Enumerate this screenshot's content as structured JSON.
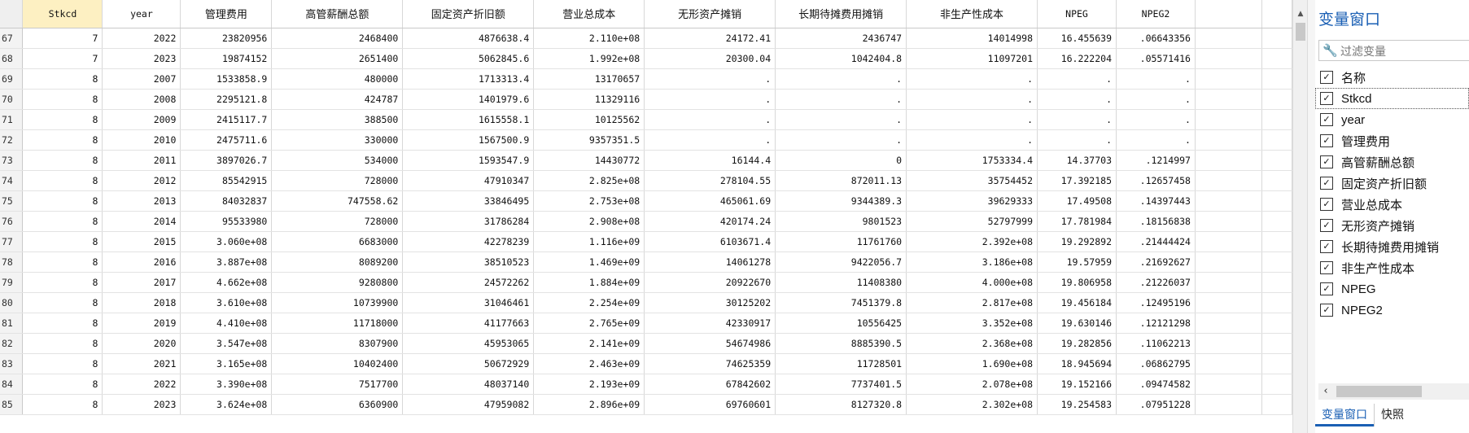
{
  "columns": [
    "Stkcd",
    "year",
    "管理费用",
    "高管薪酬总额",
    "固定资产折旧额",
    "营业总成本",
    "无形资产摊销",
    "长期待摊费用摊销",
    "非生产性成本",
    "NPEG",
    "NPEG2"
  ],
  "rows": [
    [
      "67",
      "7",
      "2022",
      "23820956",
      "2468400",
      "4876638.4",
      "2.110e+08",
      "24172.41",
      "2436747",
      "14014998",
      "16.455639",
      ".06643356"
    ],
    [
      "68",
      "7",
      "2023",
      "19874152",
      "2651400",
      "5062845.6",
      "1.992e+08",
      "20300.04",
      "1042404.8",
      "11097201",
      "16.222204",
      ".05571416"
    ],
    [
      "69",
      "8",
      "2007",
      "1533858.9",
      "480000",
      "1713313.4",
      "13170657",
      ".",
      ".",
      ".",
      ".",
      "."
    ],
    [
      "70",
      "8",
      "2008",
      "2295121.8",
      "424787",
      "1401979.6",
      "11329116",
      ".",
      ".",
      ".",
      ".",
      "."
    ],
    [
      "71",
      "8",
      "2009",
      "2415117.7",
      "388500",
      "1615558.1",
      "10125562",
      ".",
      ".",
      ".",
      ".",
      "."
    ],
    [
      "72",
      "8",
      "2010",
      "2475711.6",
      "330000",
      "1567500.9",
      "9357351.5",
      ".",
      ".",
      ".",
      ".",
      "."
    ],
    [
      "73",
      "8",
      "2011",
      "3897026.7",
      "534000",
      "1593547.9",
      "14430772",
      "16144.4",
      "0",
      "1753334.4",
      "14.37703",
      ".1214997"
    ],
    [
      "74",
      "8",
      "2012",
      "85542915",
      "728000",
      "47910347",
      "2.825e+08",
      "278104.55",
      "872011.13",
      "35754452",
      "17.392185",
      ".12657458"
    ],
    [
      "75",
      "8",
      "2013",
      "84032837",
      "747558.62",
      "33846495",
      "2.753e+08",
      "465061.69",
      "9344389.3",
      "39629333",
      "17.49508",
      ".14397443"
    ],
    [
      "76",
      "8",
      "2014",
      "95533980",
      "728000",
      "31786284",
      "2.908e+08",
      "420174.24",
      "9801523",
      "52797999",
      "17.781984",
      ".18156838"
    ],
    [
      "77",
      "8",
      "2015",
      "3.060e+08",
      "6683000",
      "42278239",
      "1.116e+09",
      "6103671.4",
      "11761760",
      "2.392e+08",
      "19.292892",
      ".21444424"
    ],
    [
      "78",
      "8",
      "2016",
      "3.887e+08",
      "8089200",
      "38510523",
      "1.469e+09",
      "14061278",
      "9422056.7",
      "3.186e+08",
      "19.57959",
      ".21692627"
    ],
    [
      "79",
      "8",
      "2017",
      "4.662e+08",
      "9280800",
      "24572262",
      "1.884e+09",
      "20922670",
      "11408380",
      "4.000e+08",
      "19.806958",
      ".21226037"
    ],
    [
      "80",
      "8",
      "2018",
      "3.610e+08",
      "10739900",
      "31046461",
      "2.254e+09",
      "30125202",
      "7451379.8",
      "2.817e+08",
      "19.456184",
      ".12495196"
    ],
    [
      "81",
      "8",
      "2019",
      "4.410e+08",
      "11718000",
      "41177663",
      "2.765e+09",
      "42330917",
      "10556425",
      "3.352e+08",
      "19.630146",
      ".12121298"
    ],
    [
      "82",
      "8",
      "2020",
      "3.547e+08",
      "8307900",
      "45953065",
      "2.141e+09",
      "54674986",
      "8885390.5",
      "2.368e+08",
      "19.282856",
      ".11062213"
    ],
    [
      "83",
      "8",
      "2021",
      "3.165e+08",
      "10402400",
      "50672929",
      "2.463e+09",
      "74625359",
      "11728501",
      "1.690e+08",
      "18.945694",
      ".06862795"
    ],
    [
      "84",
      "8",
      "2022",
      "3.390e+08",
      "7517700",
      "48037140",
      "2.193e+09",
      "67842602",
      "7737401.5",
      "2.078e+08",
      "19.152166",
      ".09474582"
    ],
    [
      "85",
      "8",
      "2023",
      "3.624e+08",
      "6360900",
      "47959082",
      "2.896e+09",
      "69760601",
      "8127320.8",
      "2.302e+08",
      "19.254583",
      ".07951228"
    ]
  ],
  "var_panel": {
    "title": "变量窗口",
    "filter_placeholder": "过滤变量",
    "name_header": "名称",
    "variables": [
      "Stkcd",
      "year",
      "管理费用",
      "高管薪酬总额",
      "固定资产折旧额",
      "营业总成本",
      "无形资产摊销",
      "长期待摊费用摊销",
      "非生产性成本",
      "NPEG",
      "NPEG2"
    ],
    "tabs": [
      "变量窗口",
      "快照"
    ]
  },
  "icons": {
    "filter": "wrench-icon",
    "checkbox": "checkmark-icon",
    "scroll_up": "triangle-up-icon",
    "scroll_left": "chevron-left-icon"
  },
  "colors": {
    "accent": "#1a5fb4",
    "selected_header": "#fdf0c2"
  }
}
